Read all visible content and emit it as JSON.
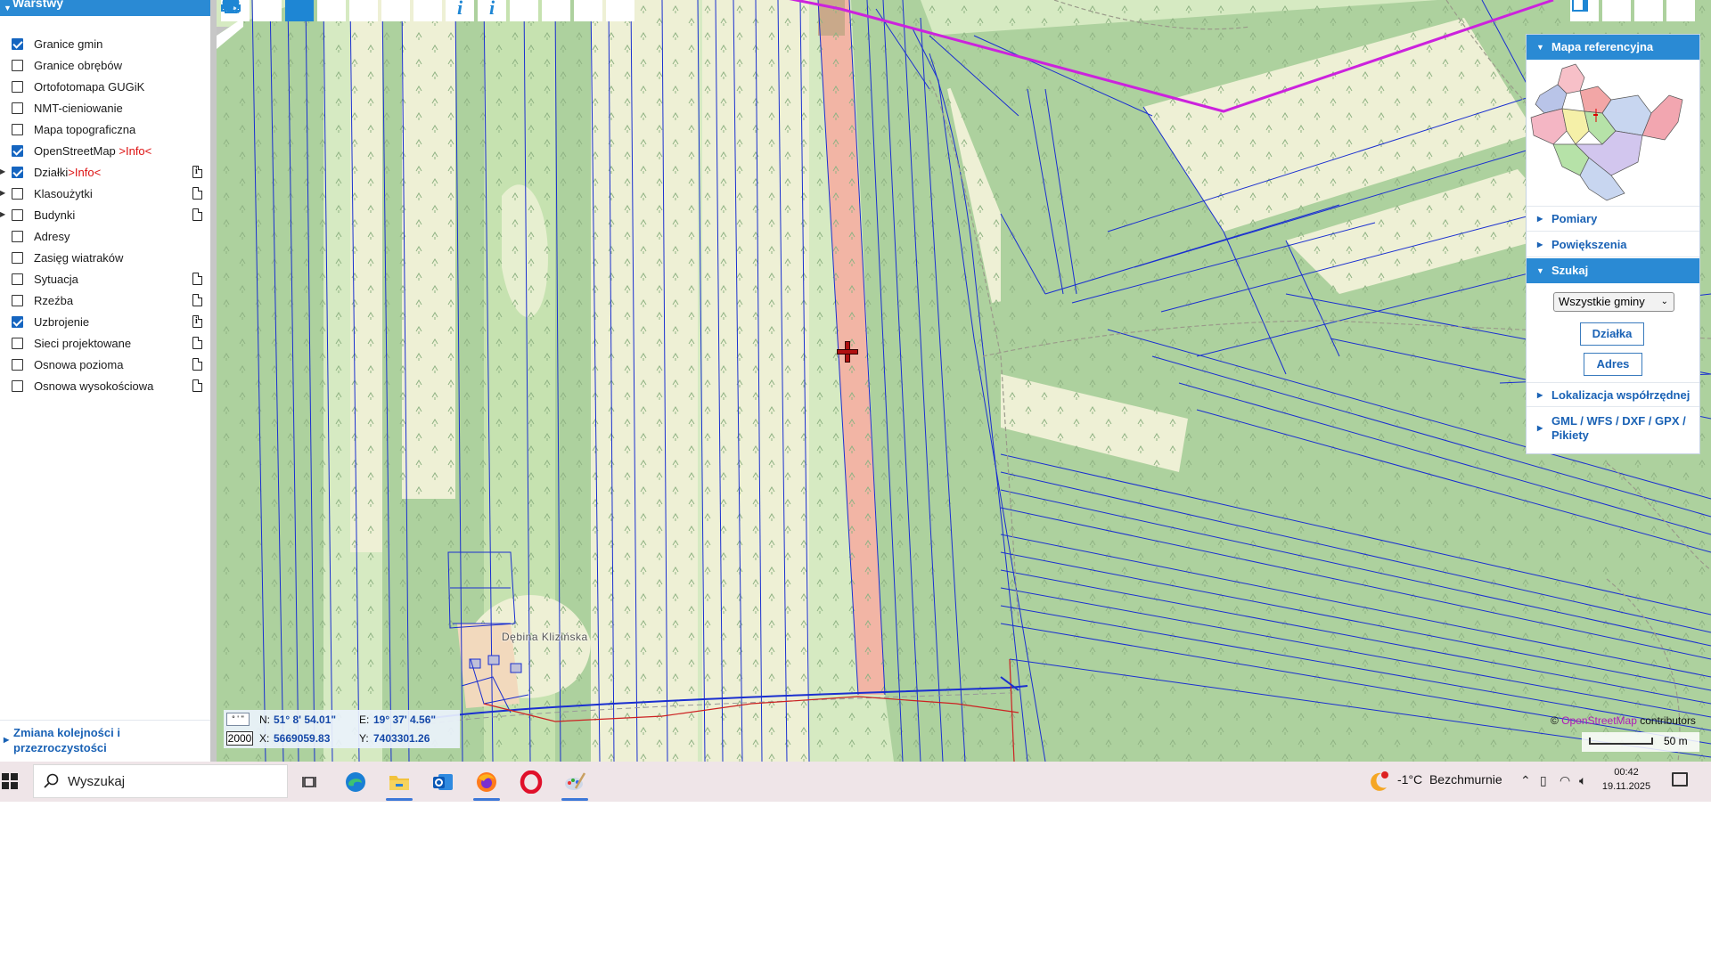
{
  "layers_panel": {
    "title": "Warstwy",
    "items": [
      {
        "label": "Granice gmin",
        "checked": true
      },
      {
        "label": "Granice obrębów",
        "checked": false
      },
      {
        "label": "Ortofotomapa GUGiK",
        "checked": false
      },
      {
        "label": "NMT-cieniowanie",
        "checked": false
      },
      {
        "label": "Mapa topograficzna",
        "checked": false
      },
      {
        "label": "OpenStreetMap ",
        "suffix": ">Info<",
        "checked": true
      },
      {
        "label": "Działki",
        "suffix": ">Info<",
        "checked": true,
        "expandable": true,
        "doc": "info"
      },
      {
        "label": "Klasoużytki",
        "checked": false,
        "expandable": true,
        "doc": "plain"
      },
      {
        "label": "Budynki",
        "checked": false,
        "expandable": true,
        "doc": "plain"
      },
      {
        "label": "Adresy",
        "checked": false
      },
      {
        "label": "Zasięg wiatraków",
        "checked": false
      },
      {
        "label": "Sytuacja",
        "checked": false,
        "doc": "plain"
      },
      {
        "label": "Rzeźba",
        "checked": false,
        "doc": "plain"
      },
      {
        "label": "Uzbrojenie",
        "checked": true,
        "doc": "info"
      },
      {
        "label": "Sieci projektowane",
        "checked": false,
        "doc": "plain"
      },
      {
        "label": "Osnowa pozioma",
        "checked": false,
        "doc": "plain"
      },
      {
        "label": "Osnowa wysokościowa",
        "checked": false,
        "doc": "plain"
      }
    ],
    "order_link": "Zmiana kolejności i przezroczystości"
  },
  "map": {
    "toolbar_icons": [
      "zoom-in-icon",
      "zoom-out-icon",
      "pan-hand-icon",
      "zoom-window-icon",
      "back-arrow-icon",
      "forward-arrow-icon",
      "link-icon",
      "info-icon",
      "info-multi-icon",
      "measure-icon",
      "print-icon",
      "globe-icon",
      "video-icon"
    ],
    "right_icons": [
      "panel-top-icon",
      "panel-left-icon",
      "panel-arrow-icon",
      "panel-right-icon"
    ],
    "place_name": "Dębina Klizińska",
    "coords": {
      "format_label": "° ' ''",
      "scale_value": "2000",
      "n_label": "N:",
      "n_value": "51° 8' 54.01\"",
      "e_label": "E:",
      "e_value": "19° 37' 4.56\"",
      "x_label": "X:",
      "x_value": "5669059.83",
      "y_label": "Y:",
      "y_value": "7403301.26"
    },
    "attribution_prefix": "© ",
    "attribution_link": "OpenStreetMap",
    "attribution_suffix": " contributors",
    "scale_bar_label": "50 m",
    "colors": {
      "land": "#d6eac2",
      "forest": "#add19e",
      "field": "#eef0d5",
      "parcel_line": "#1a2fd0",
      "boundary": "#cc22dd",
      "selected": "#f2b5a5"
    }
  },
  "right_panel": {
    "reference_map_title": "Mapa referencyjna",
    "pomiary": "Pomiary",
    "powiekszenia": "Powiększenia",
    "szukaj": "Szukaj",
    "select_value": "Wszystkie gminy",
    "btn_dzialka": "Działka",
    "btn_adres": "Adres",
    "lokalizacja": "Lokalizacja współrzędnej",
    "gml_line1": "GML / WFS / DXF / GPX /",
    "gml_line2": "Pikiety"
  },
  "taskbar": {
    "search_placeholder": "Wyszukaj",
    "apps": [
      "task-view-icon",
      "edge-icon",
      "file-explorer-icon",
      "outlook-icon",
      "firefox-icon",
      "opera-icon",
      "paint-icon"
    ],
    "weather_temp": "-1°C",
    "weather_desc": "Bezchmurnie",
    "time": "00:42",
    "date": "19.11.2025"
  }
}
